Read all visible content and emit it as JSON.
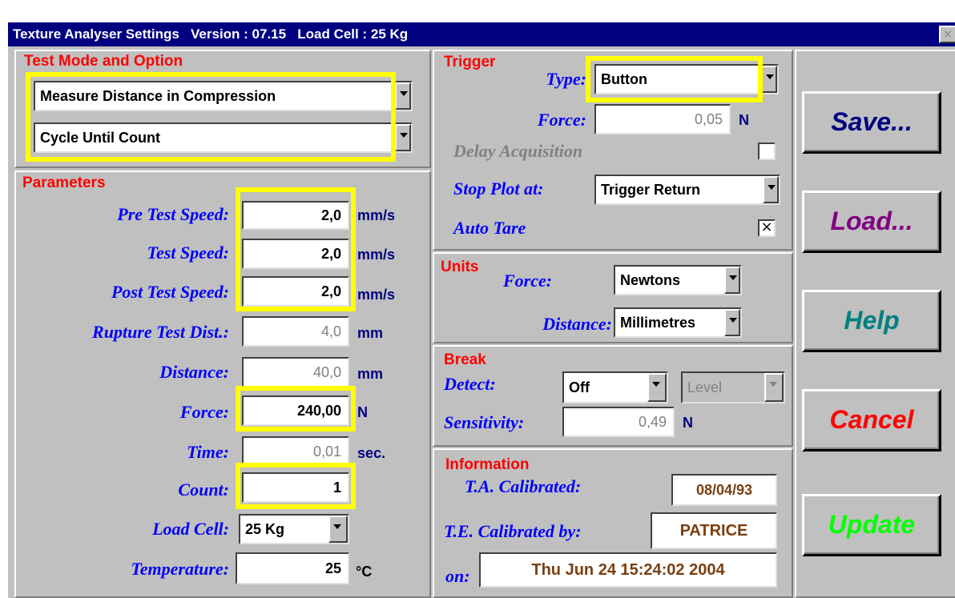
{
  "window": {
    "title": "Texture Analyser Settings   Version : 07.15   Load Cell : 25 Kg",
    "close_glyph": "×"
  },
  "test_mode": {
    "title": "Test Mode and Option",
    "mode_value": "Measure Distance in Compression",
    "option_value": "Cycle Until Count"
  },
  "parameters": {
    "title": "Parameters",
    "pre_test_speed": {
      "label": "Pre Test Speed:",
      "value": "2,0",
      "unit": "mm/s"
    },
    "test_speed": {
      "label": "Test Speed:",
      "value": "2,0",
      "unit": "mm/s"
    },
    "post_test_speed": {
      "label": "Post Test Speed:",
      "value": "2,0",
      "unit": "mm/s"
    },
    "rupture_test_dist": {
      "label": "Rupture Test Dist.:",
      "value": "4,0",
      "unit": "mm"
    },
    "distance": {
      "label": "Distance:",
      "value": "40,0",
      "unit": "mm"
    },
    "force": {
      "label": "Force:",
      "value": "240,00",
      "unit": "N"
    },
    "time": {
      "label": "Time:",
      "value": "0,01",
      "unit": "sec."
    },
    "count": {
      "label": "Count:",
      "value": "1"
    },
    "load_cell": {
      "label": "Load Cell:",
      "value": "25 Kg"
    },
    "temperature": {
      "label": "Temperature:",
      "value": "25",
      "unit": "°C"
    }
  },
  "trigger": {
    "title": "Trigger",
    "type_label": "Type:",
    "type_value": "Button",
    "force_label": "Force:",
    "force_value": "0,05",
    "force_unit": "N",
    "delay_label": "Delay Acquisition",
    "delay_checked": false,
    "stop_plot_label": "Stop Plot at:",
    "stop_plot_value": "Trigger Return",
    "auto_tare_label": "Auto Tare",
    "auto_tare_checked": true,
    "check_mark": "×"
  },
  "units": {
    "title": "Units",
    "force_label": "Force:",
    "force_value": "Newtons",
    "distance_label": "Distance:",
    "distance_value": "Millimetres"
  },
  "break": {
    "title": "Break",
    "detect_label": "Detect:",
    "detect_value": "Off",
    "level_value": "Level",
    "sensitivity_label": "Sensitivity:",
    "sensitivity_value": "0,49",
    "sensitivity_unit": "N"
  },
  "information": {
    "title": "Information",
    "ta_calibrated_label": "T.A. Calibrated:",
    "ta_calibrated_value": "08/04/93",
    "te_calibrated_by_label": "T.E. Calibrated by:",
    "te_calibrated_by_value": "PATRICE",
    "on_label": "on:",
    "on_value": "Thu Jun 24 15:24:02 2004"
  },
  "buttons": {
    "save": {
      "label": "Save...",
      "color": "#000080"
    },
    "load": {
      "label": "Load...",
      "color": "#800080"
    },
    "help": {
      "label": "Help",
      "color": "#008080"
    },
    "cancel": {
      "label": "Cancel",
      "color": "#ff0000"
    },
    "update": {
      "label": "Update",
      "color": "#00ff00"
    }
  },
  "colors": {
    "titlebar": "#000080",
    "highlight": "#ffff00",
    "panel": "#c0c0c0",
    "label_blue": "#0000ff",
    "section_red": "#ff0000",
    "info_brown": "#7a3f10"
  }
}
